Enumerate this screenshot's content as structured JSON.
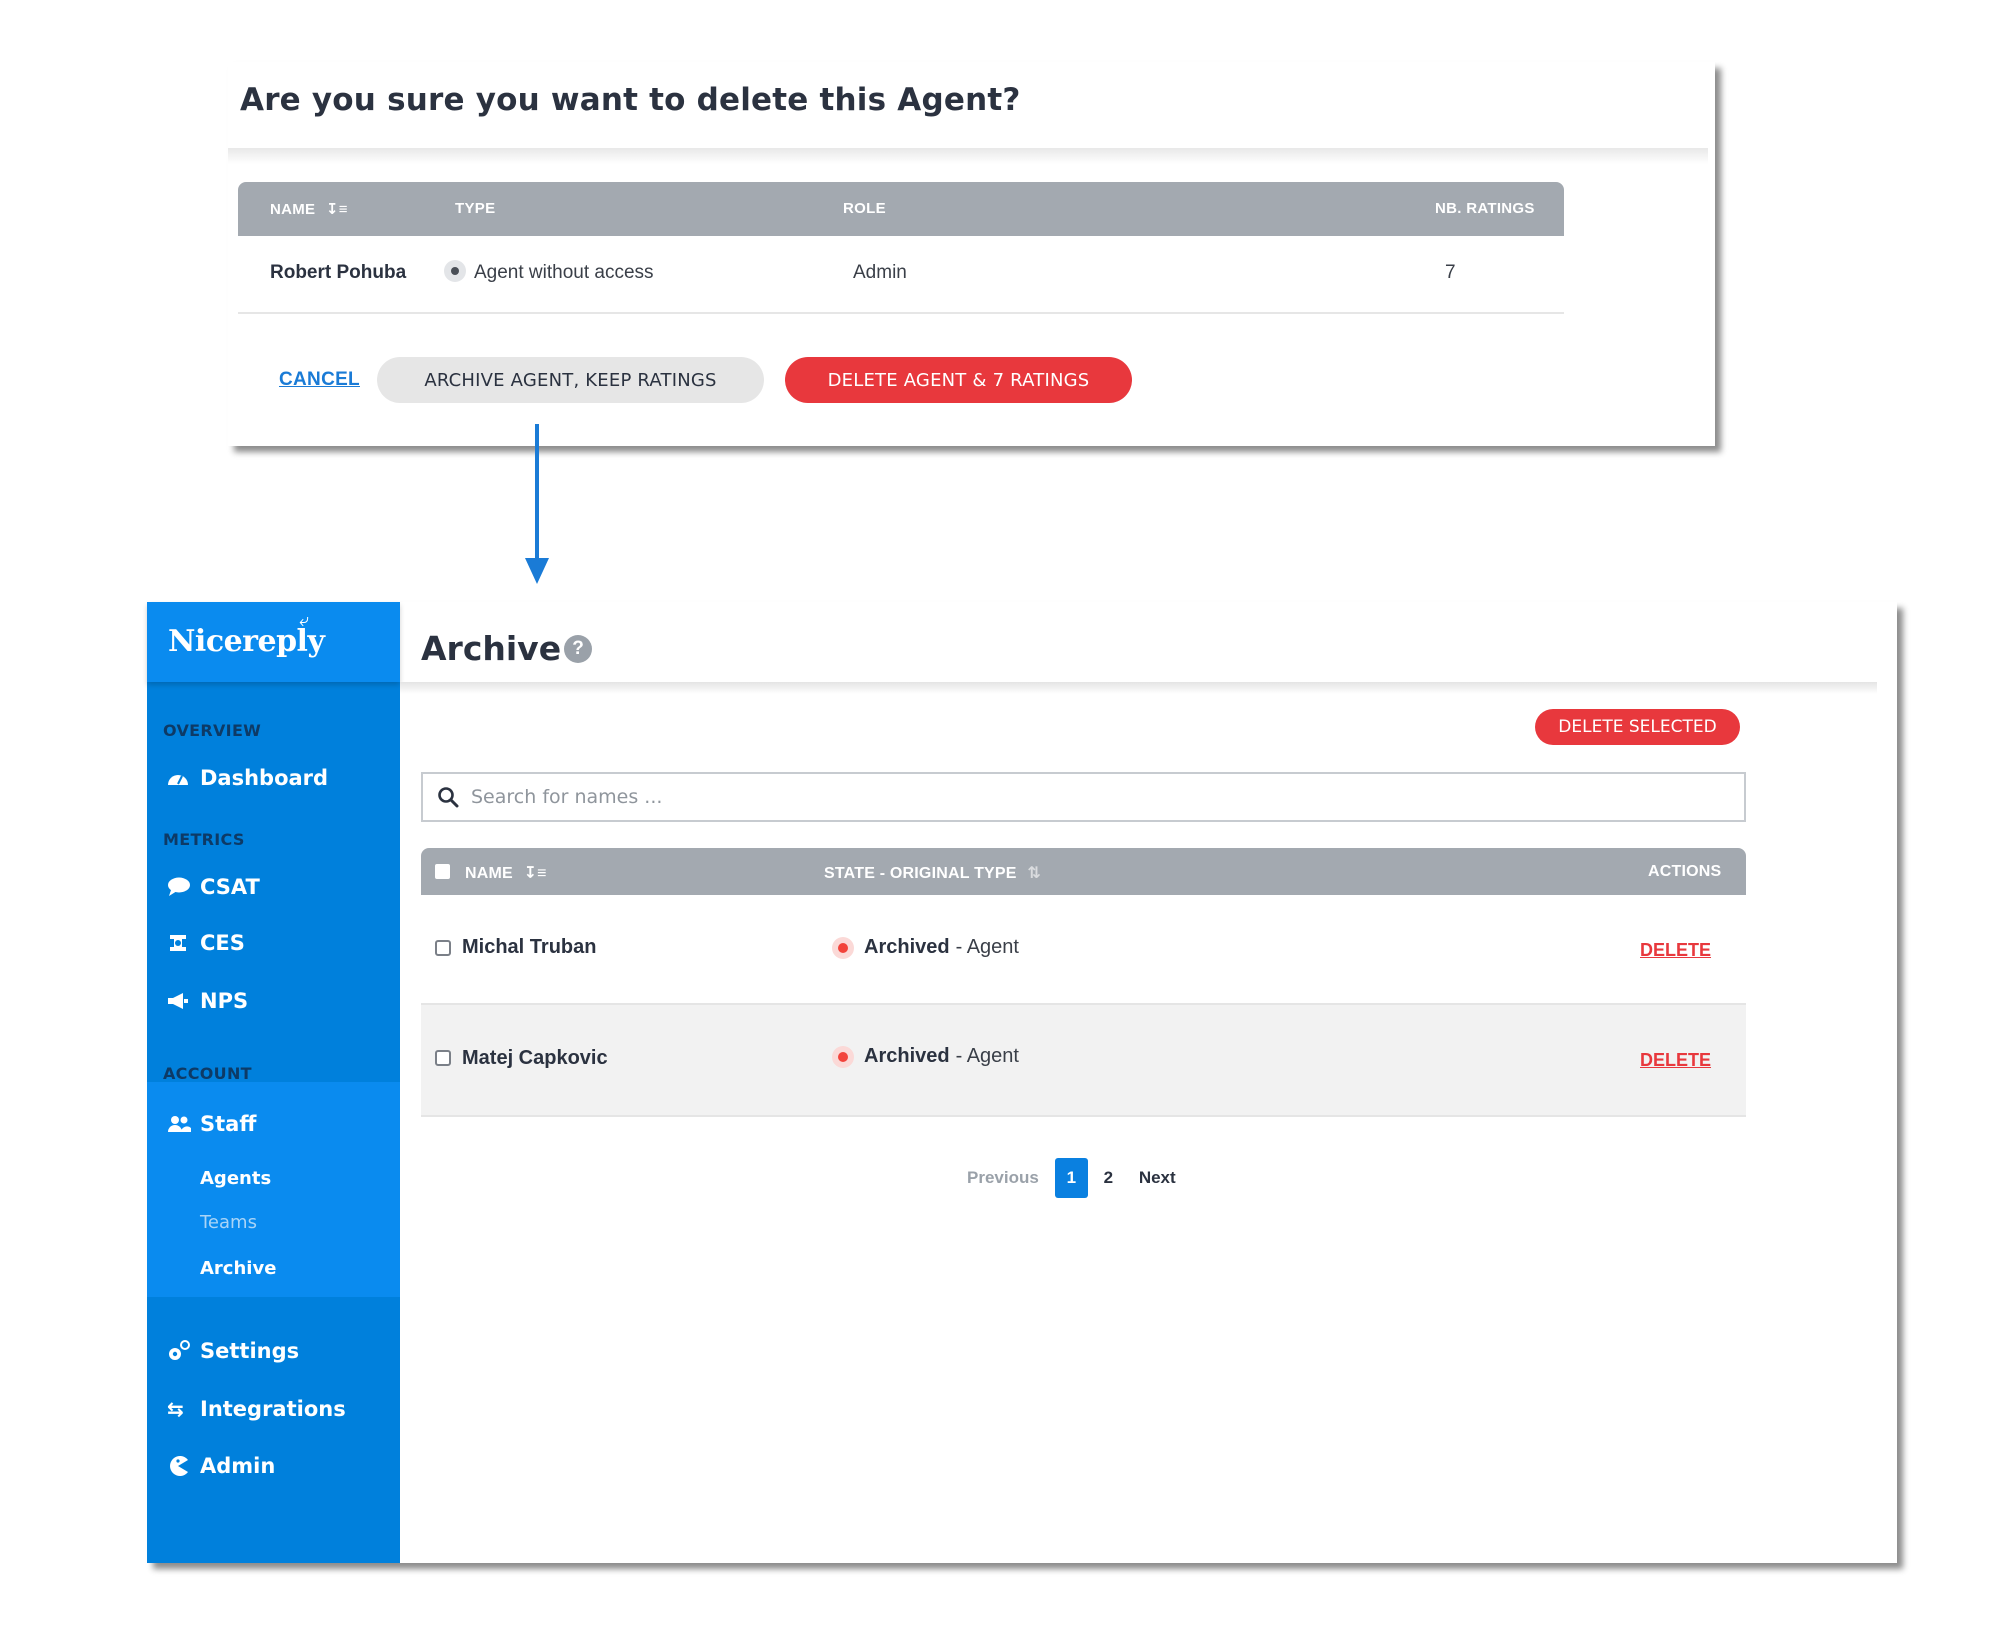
{
  "dialog": {
    "title": "Are you sure you want to delete this Agent?",
    "columns": [
      {
        "label": "NAME",
        "sort_icon": "sort-alpha-down-icon"
      },
      {
        "label": "TYPE"
      },
      {
        "label": "ROLE"
      },
      {
        "label": "NB. RATINGS"
      }
    ],
    "row": {
      "name": "Robert Pohuba",
      "type": "Agent without access",
      "role": "Admin",
      "ratings": "7"
    },
    "cancel_label": "CANCEL",
    "archive_label": "ARCHIVE AGENT, KEEP RATINGS",
    "delete_label": "DELETE AGENT & 7 RATINGS"
  },
  "sidebar": {
    "logo": "Nicereply",
    "sections": {
      "overview": "OVERVIEW",
      "metrics": "METRICS",
      "account": "ACCOUNT"
    },
    "items": {
      "dashboard": {
        "label": "Dashboard",
        "icon": "gauge-icon"
      },
      "csat": {
        "label": "CSAT",
        "icon": "speech-bubble-icon"
      },
      "ces": {
        "label": "CES",
        "icon": "ces-icon"
      },
      "nps": {
        "label": "NPS",
        "icon": "megaphone-icon"
      },
      "staff": {
        "label": "Staff",
        "icon": "users-icon"
      },
      "settings": {
        "label": "Settings",
        "icon": "gears-icon"
      },
      "integrations": {
        "label": "Integrations",
        "icon": "arrows-exchange-icon"
      },
      "admin": {
        "label": "Admin",
        "icon": "pacman-icon"
      }
    },
    "staff_sub": {
      "agents": "Agents",
      "teams": "Teams",
      "archive": "Archive"
    }
  },
  "main": {
    "title": "Archive",
    "help": "?",
    "delete_selected_label": "DELETE SELECTED",
    "search": {
      "placeholder": "Search for names ...",
      "value": ""
    },
    "columns": {
      "name": "NAME",
      "state": "STATE - ORIGINAL TYPE",
      "actions": "ACTIONS"
    },
    "rows": [
      {
        "name": "Michal Truban",
        "state": "Archived",
        "type": "- Agent",
        "action": "DELETE"
      },
      {
        "name": "Matej Capkovic",
        "state": "Archived",
        "type": "- Agent",
        "action": "DELETE"
      }
    ],
    "pagination": {
      "previous": "Previous",
      "pages": [
        "1",
        "2"
      ],
      "current": "1",
      "next": "Next"
    }
  },
  "colors": {
    "brand_blue": "#0a8bef",
    "sidebar_blue": "#0080dc",
    "danger_red": "#e8383d",
    "table_header_gray": "#a3a9b0",
    "link_blue": "#1a7bd6"
  }
}
